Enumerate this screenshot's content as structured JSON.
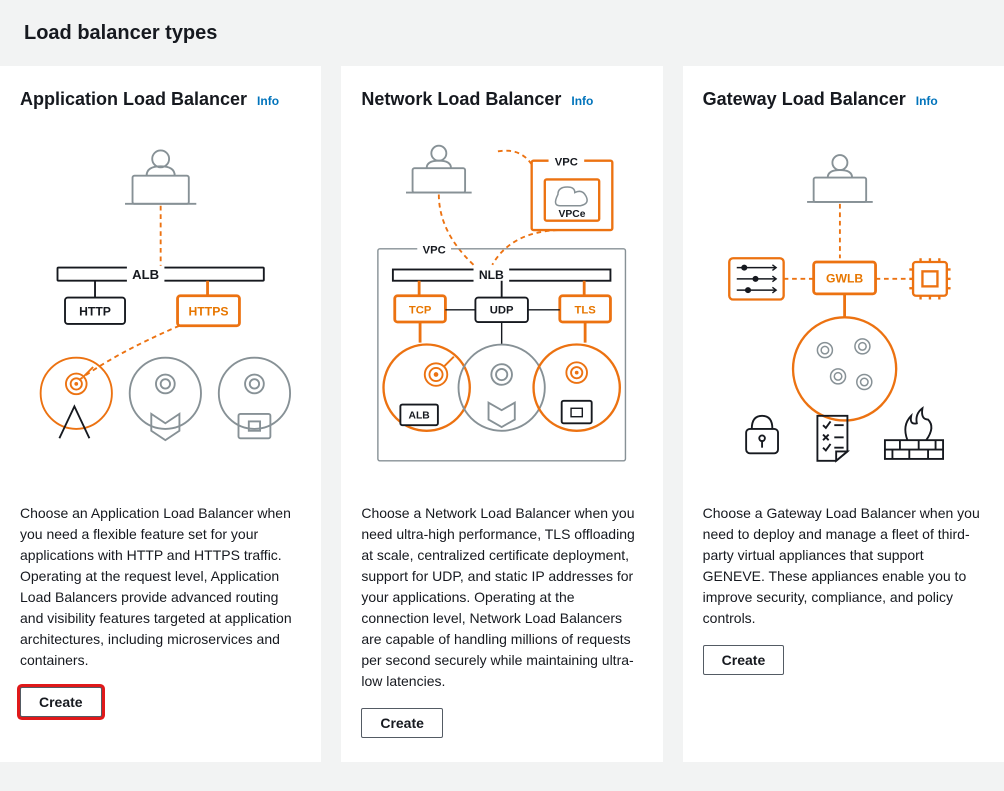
{
  "page": {
    "title": "Load balancer types"
  },
  "info_label": "Info",
  "create_label": "Create",
  "cards": {
    "alb": {
      "title": "Application Load Balancer",
      "desc": "Choose an Application Load Balancer when you need a flexible feature set for your applications with HTTP and HTTPS traffic. Operating at the request level, Application Load Balancers provide advanced routing and visibility features targeted at application architectures, including microservices and containers.",
      "labels": {
        "bar": "ALB",
        "http": "HTTP",
        "https": "HTTPS"
      }
    },
    "nlb": {
      "title": "Network Load Balancer",
      "desc": "Choose a Network Load Balancer when you need ultra-high performance, TLS offloading at scale, centralized certificate deployment, support for UDP, and static IP addresses for your applications. Operating at the connection level, Network Load Balancers are capable of handling millions of requests per second securely while maintaining ultra-low latencies.",
      "labels": {
        "bar": "NLB",
        "vpc": "VPC",
        "vpce": "VPCe",
        "tcp": "TCP",
        "udp": "UDP",
        "tls": "TLS",
        "alb": "ALB"
      }
    },
    "gwlb": {
      "title": "Gateway Load Balancer",
      "desc": "Choose a Gateway Load Balancer when you need to deploy and manage a fleet of third-party virtual appliances that support GENEVE. These appliances enable you to improve security, compliance, and policy controls.",
      "labels": {
        "bar": "GWLB"
      }
    }
  }
}
